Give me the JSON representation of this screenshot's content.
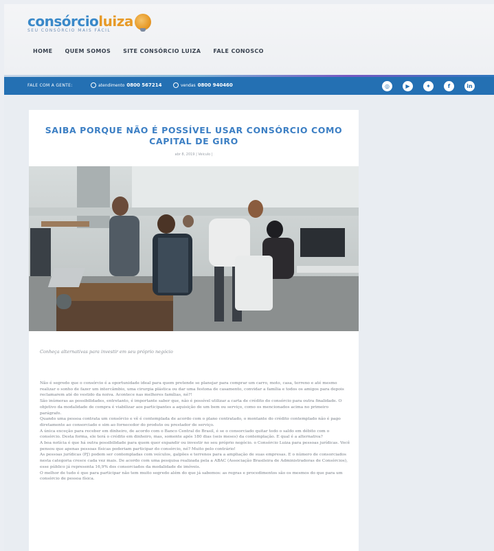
{
  "logo": {
    "part1": "consórcio",
    "part2": "luiza",
    "tagline": "SEU CONSÓRCIO MAIS FÁCIL"
  },
  "nav": [
    "HOME",
    "QUEM SOMOS",
    "SITE CONSÓRCIO LUIZA",
    "FALE CONOSCO"
  ],
  "topbar": {
    "fale": "FALE COM A GENTE:",
    "phone1_label": "atendimento",
    "phone1_number": "0800 567214",
    "phone2_label": "vendas",
    "phone2_number": "0800 940460",
    "social_icons": [
      "instagram-icon",
      "youtube-icon",
      "twitter-icon",
      "facebook-icon",
      "linkedin-icon"
    ]
  },
  "article": {
    "title": "SAIBA PORQUE NÃO É POSSÍVEL USAR CONSÓRCIO COMO CAPITAL DE GIRO",
    "meta": "abr 8, 2019 | Veiculo |",
    "caption": "Conheça alternativas para investir em seu próprio negócio",
    "paragraphs": [
      "Não é segredo que o consórcio é a oportunidade ideal para quem pretende se planejar para comprar um carro, moto, casa, terreno e até mesmo realizar o sonho de fazer um intercâmbio, uma cirurgia plástica ou dar uma festona de casamento, convidar a família e todos os amigos para depois reclamarem até do vestido da noiva. Acontece nas melhores famílias, né?!",
      "São inúmeras as possibilidades, entretanto, é importante saber que, não é possível utilizar a carta de crédito do consórcio para outra finalidade. O objetivo da modalidade de compra é viabilizar aos participantes a aquisição de um bem ou serviço, como os mencionados acima no primeiro parágrafo.",
      "Quando uma pessoa contrata um consórcio e vê é contemplada de acordo com o plano contratado, o montante do crédito contemplado não é pago diretamente ao consorciado e sim ao fornecedor do produto ou prestador de serviço.",
      "A única exceção para receber em dinheiro, de acordo com o Banco Central do Brasil, é se o consorciado quitar todo o saldo em débito com o consórcio. Desta forma, ele terá o crédito em dinheiro, mas, somente após 180 dias (seis meses) da contemplação. E qual é a alternativa?",
      "A boa notícia é que há outra possibilidade para quem quer expandir ou investir no seu próprio negócio. o Consórcio Luiza para pessoas jurídicas. Você pensou que apenas pessoas físicas poderiam participar do consórcio, né? Muito pelo contrário!",
      "As pessoas jurídicas (PJ) podem ser contempladas com veículos, galpões e terrenos para a ampliação de suas empresas. E o número de consorciados nesta categoria cresce cada vez mais. De acordo com uma pesquisa realizada pela a ABAC (Associação Brasileira de Administradoras de Consórcios), esse público já representa 16,9% dos consorciados da modalidade de imóveis.",
      "O melhor de tudo é que para participar não tem muito segredo além do que já sabemos: as regras e procedimentos são os mesmos do que para um consórcio de pessoa física."
    ]
  },
  "colors": {
    "accent": "#3c7fc4",
    "topbar": "#2470b3",
    "logo_orange": "#e79a28"
  }
}
